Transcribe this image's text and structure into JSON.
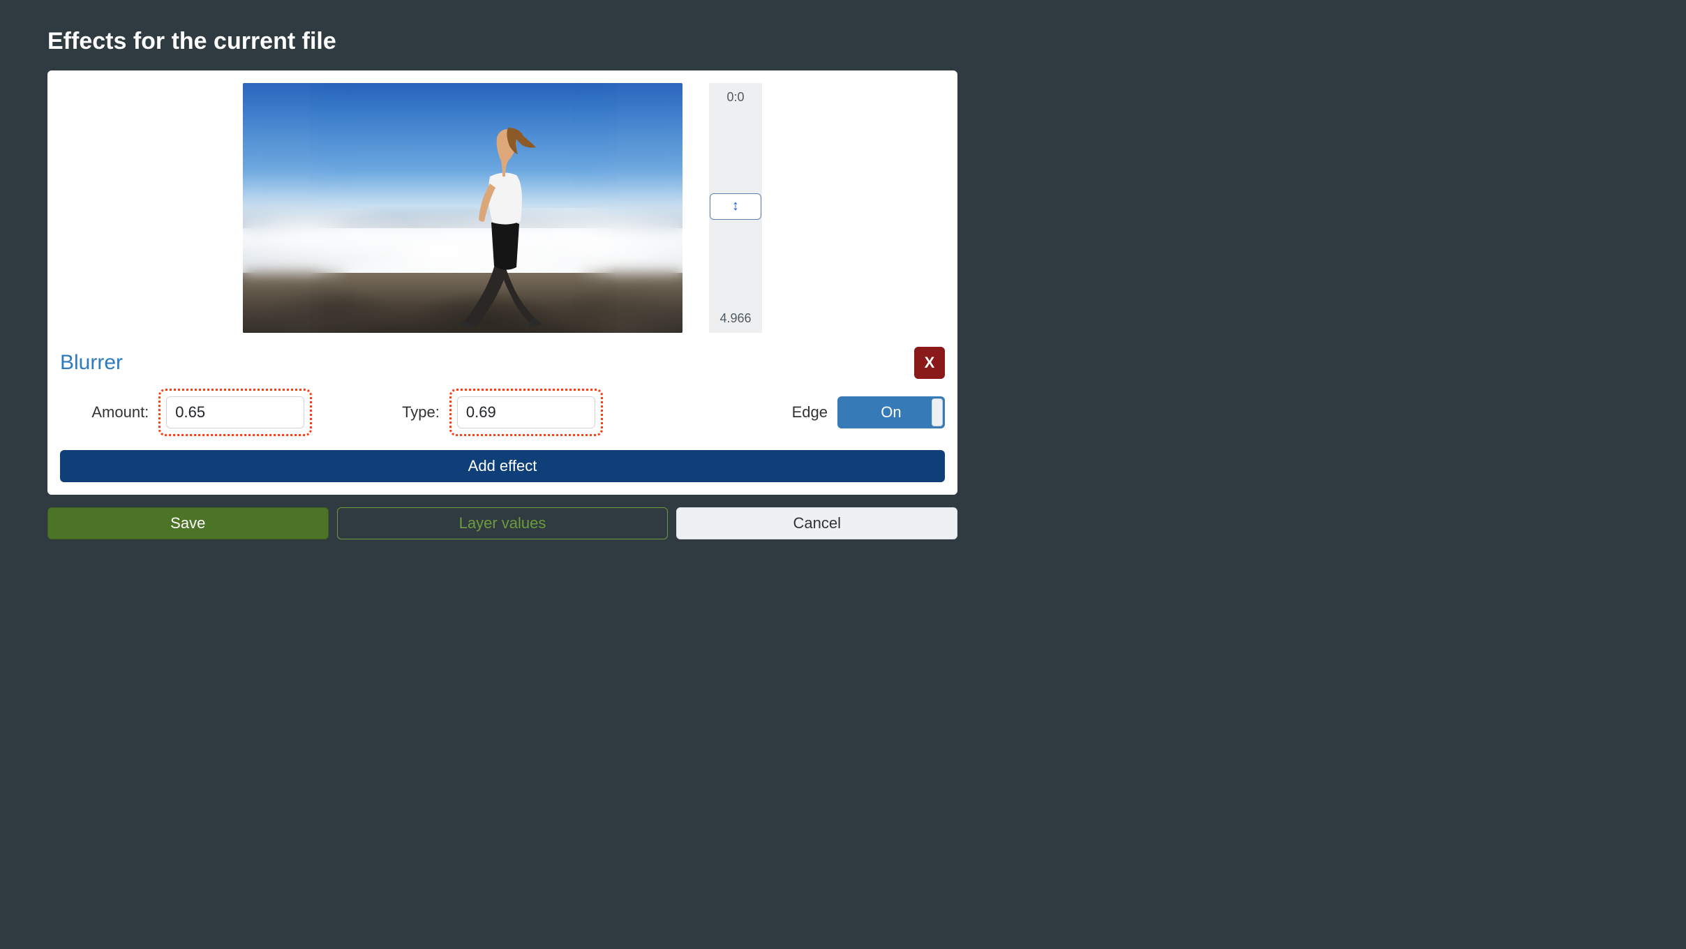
{
  "page": {
    "title": "Effects for the current file"
  },
  "preview": {
    "slider": {
      "min_label": "0:0",
      "max_label": "4.966"
    }
  },
  "effect": {
    "name": "Blurrer",
    "remove_label": "X",
    "params": {
      "amount": {
        "label": "Amount:",
        "value": "0.65"
      },
      "type": {
        "label": "Type:",
        "value": "0.69"
      },
      "edge": {
        "label": "Edge",
        "state": "On"
      }
    }
  },
  "add_effect_label": "Add effect",
  "footer": {
    "save": "Save",
    "layer_values": "Layer values",
    "cancel": "Cancel"
  }
}
